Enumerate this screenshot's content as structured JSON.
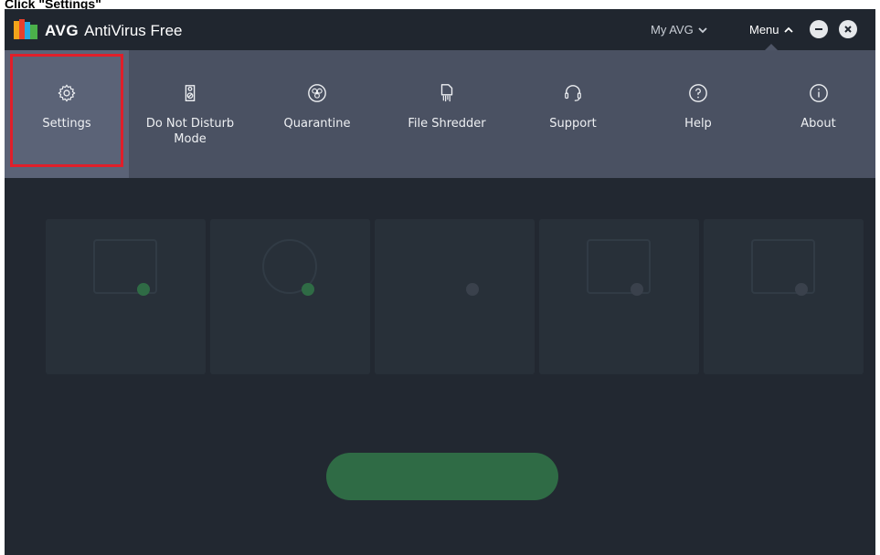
{
  "instruction": "Click \"Settings\"",
  "app": {
    "brand": "AVG",
    "product": "AntiVirus Free",
    "my_avg_label": "My AVG",
    "menu_label": "Menu"
  },
  "menu": {
    "items": [
      {
        "label": "Settings",
        "icon": "gear-icon"
      },
      {
        "label": "Do Not Disturb Mode",
        "icon": "door-hanger-icon"
      },
      {
        "label": "Quarantine",
        "icon": "biohazard-icon"
      },
      {
        "label": "File Shredder",
        "icon": "shredder-icon"
      },
      {
        "label": "Support",
        "icon": "headset-icon"
      },
      {
        "label": "Help",
        "icon": "question-icon"
      },
      {
        "label": "About",
        "icon": "info-icon"
      }
    ]
  },
  "colors": {
    "highlight": "#e01f2a",
    "active_item": "#5b6377",
    "dropdown": "#4a5162",
    "titlebar": "#20262f"
  }
}
